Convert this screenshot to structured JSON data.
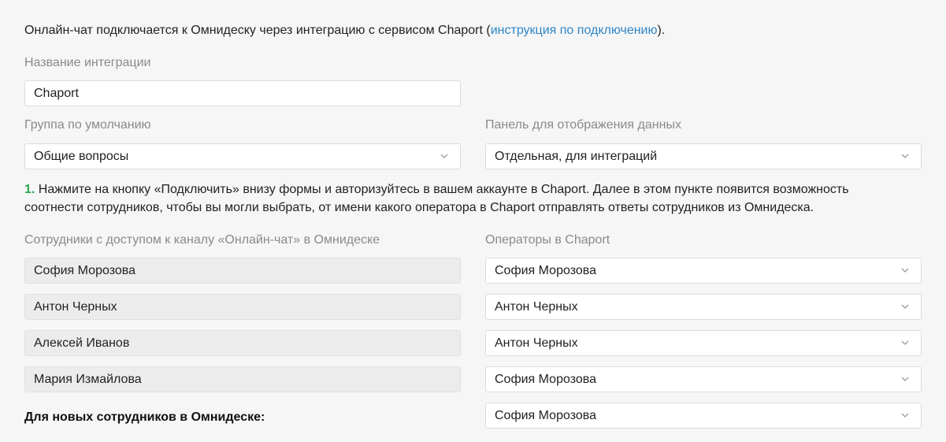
{
  "intro": {
    "text_before": "Онлайн-чат подключается к Омнидеску через интеграцию с сервисом Chaport (",
    "link_text": "инструкция по подключению",
    "text_after": ")."
  },
  "integration_name": {
    "label": "Название интеграции",
    "value": "Chaport"
  },
  "default_group": {
    "label": "Группа по умолчанию",
    "value": "Общие вопросы"
  },
  "data_panel": {
    "label": "Панель для отображения данных",
    "value": "Отдельная, для интеграций"
  },
  "step1": {
    "number": "1.",
    "text": "Нажмите на кнопку «Подключить» внизу формы и авторизуйтесь в вашем аккаунте в Chaport. Далее в этом пункте появится возможность соотнести сотрудников, чтобы вы могли выбрать, от имени какого оператора в Chaport отправлять ответы сотрудников из Омнидеска."
  },
  "mapping": {
    "employees_label": "Сотрудники с доступом к каналу «Онлайн-чат» в Омнидеске",
    "operators_label": "Операторы в Chaport",
    "rows": [
      {
        "employee": "София Морозова",
        "operator": "София Морозова"
      },
      {
        "employee": "Антон Черных",
        "operator": "Антон Черных"
      },
      {
        "employee": "Алексей Иванов",
        "operator": "Антон Черных"
      },
      {
        "employee": "Мария Измайлова",
        "operator": "София Морозова"
      }
    ],
    "new_employees_label": "Для новых сотрудников в Омнидеске:",
    "new_employees_operator": "София Морозова"
  },
  "icons": {
    "dropdown": "chevron-down-icon"
  },
  "colors": {
    "link": "#2f86c8",
    "step_number": "#2fa84f",
    "label": "#8a8a8a"
  }
}
